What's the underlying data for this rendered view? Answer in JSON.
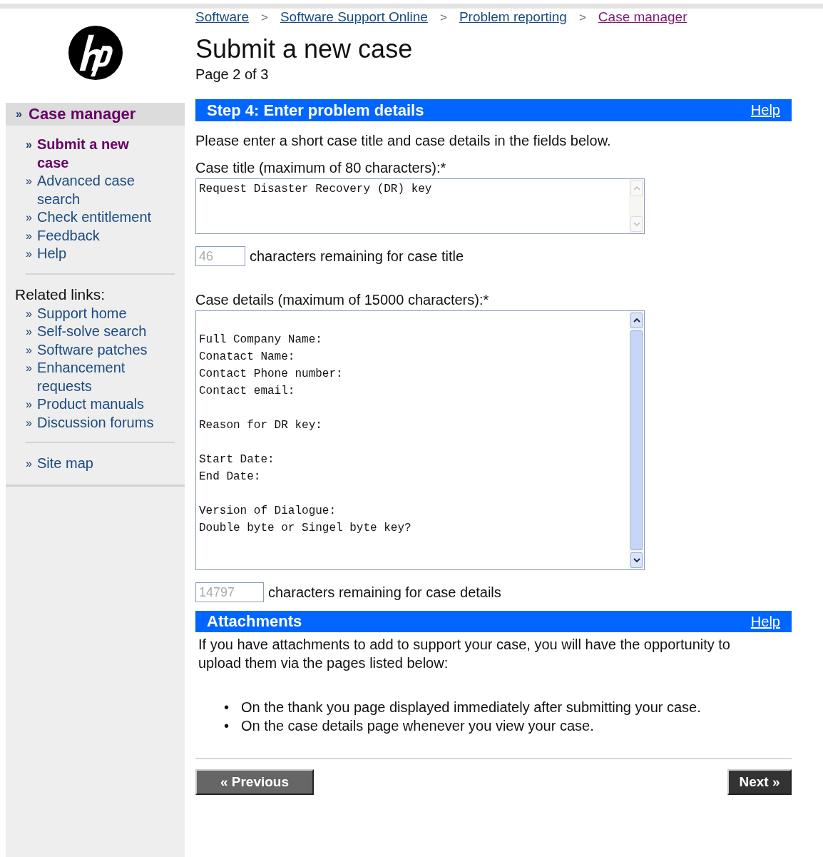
{
  "breadcrumb": [
    {
      "label": "Software",
      "separator": ">",
      "visited": false
    },
    {
      "label": "Software Support Online",
      "separator": ">",
      "visited": false
    },
    {
      "label": "Problem reporting",
      "separator": ">",
      "visited": false
    },
    {
      "label": "Case manager",
      "visited": true
    }
  ],
  "page": {
    "title": "Submit a new case",
    "subtitle": "Page 2 of 3"
  },
  "sidebar": {
    "heading": {
      "marker": "»",
      "label": "Case manager"
    },
    "items": [
      {
        "marker": "»",
        "label": "Submit a new case",
        "selected": true
      },
      {
        "marker": "»",
        "label": "Advanced case search",
        "selected": false
      },
      {
        "marker": "»",
        "label": "Check entitlement",
        "selected": false
      },
      {
        "marker": "»",
        "label": "Feedback",
        "selected": false
      },
      {
        "marker": "»",
        "label": "Help",
        "selected": false
      }
    ],
    "related_title": "Related links:",
    "related": [
      {
        "marker": "»",
        "label": "Support home"
      },
      {
        "marker": "»",
        "label": "Self-solve search"
      },
      {
        "marker": "»",
        "label": "Software patches"
      },
      {
        "marker": "»",
        "label": "Enhancement requests"
      },
      {
        "marker": "»",
        "label": "Product manuals"
      },
      {
        "marker": "»",
        "label": "Discussion forums"
      }
    ],
    "site_map": {
      "marker": "»",
      "label": "Site map"
    }
  },
  "step": {
    "title": "Step 4: Enter problem details",
    "help": "Help",
    "intro": "Please enter a short case title and case details in the fields below.",
    "title_label": "Case title (maximum of 80 characters):*",
    "title_value": "Request Disaster Recovery (DR) key",
    "title_remaining": "46",
    "title_remaining_label": "characters remaining for case title",
    "details_label": "Case details (maximum of 15000 characters):*",
    "details_value": "Full Company Name:\nConatact Name:\nContact Phone number:\nContact email:\n\nReason for DR key:\n\nStart Date:\nEnd Date:\n\nVersion of Dialogue:\nDouble byte or Singel byte key?",
    "details_remaining": "14797",
    "details_remaining_label": "characters remaining for case details"
  },
  "attachments": {
    "title": "Attachments",
    "help": "Help",
    "text": "If you have attachments to add to support your case, you will have the opportunity to upload them via the pages listed below:",
    "items": [
      {
        "bullet": "•",
        "text": "On the thank you page displayed immediately after submitting your case."
      },
      {
        "bullet": "•",
        "text": "On the case details page whenever you view your case."
      }
    ]
  },
  "buttons": {
    "previous": "« Previous",
    "next": "Next »"
  }
}
